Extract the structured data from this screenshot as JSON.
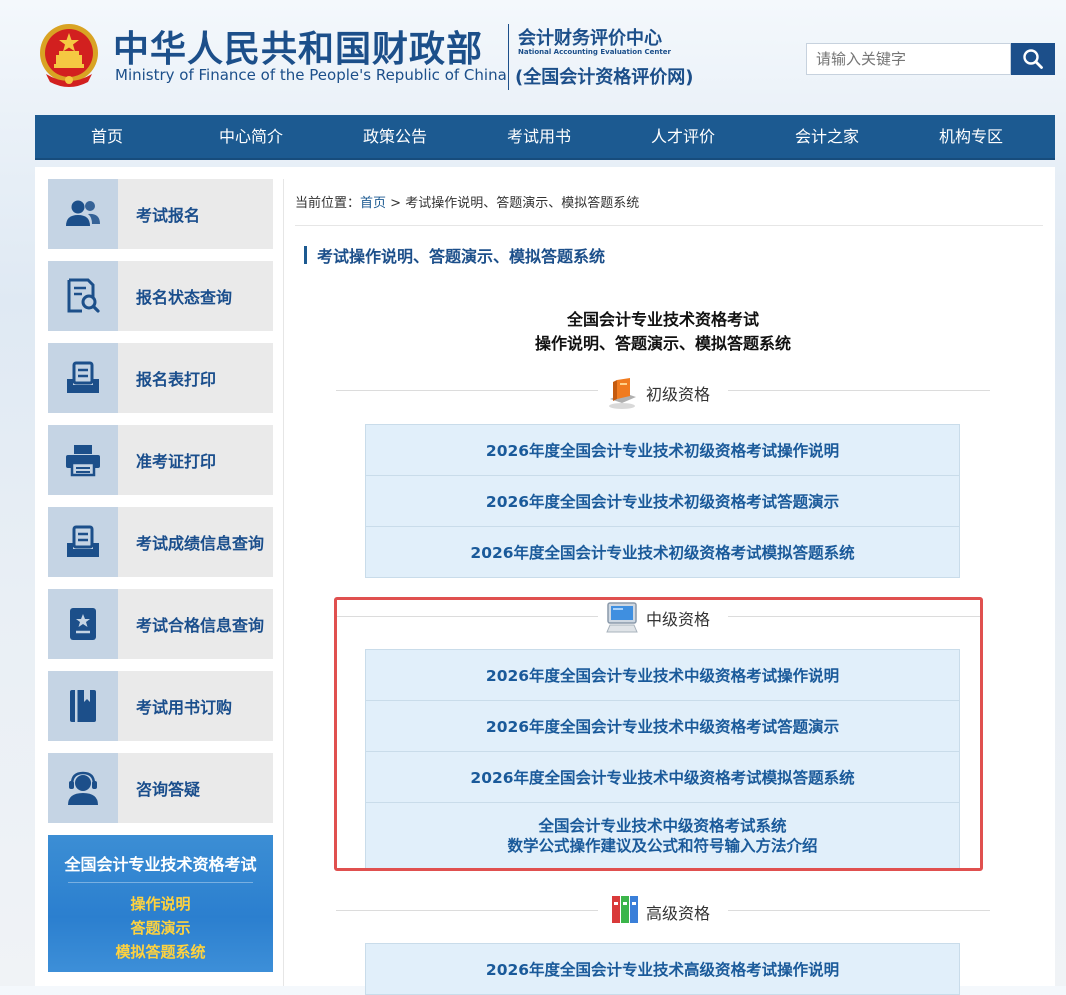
{
  "header": {
    "ministry_cn": "中华人民共和国财政部",
    "ministry_en": "Ministry of Finance of the People's Republic of China",
    "center_cn": "会计财务评价中心",
    "center_en": "National Accounting Evaluation Center",
    "center_site": "(全国会计资格评价网)",
    "search_placeholder": "请输入关键字"
  },
  "nav": [
    "首页",
    "中心简介",
    "政策公告",
    "考试用书",
    "人才评价",
    "会计之家",
    "机构专区"
  ],
  "sidebar": {
    "items": [
      {
        "label": "考试报名",
        "icon": "users-icon"
      },
      {
        "label": "报名状态查询",
        "icon": "document-search-icon"
      },
      {
        "label": "报名表打印",
        "icon": "form-print-icon"
      },
      {
        "label": "准考证打印",
        "icon": "printer-icon"
      },
      {
        "label": "考试成绩信息查询",
        "icon": "score-tray-icon"
      },
      {
        "label": "考试合格信息查询",
        "icon": "certificate-icon"
      },
      {
        "label": "考试用书订购",
        "icon": "book-icon"
      },
      {
        "label": "咨询答疑",
        "icon": "support-headset-icon"
      }
    ],
    "banner": {
      "title": "全国会计专业技术资格考试",
      "lines": [
        "操作说明",
        "答题演示",
        "模拟答题系统"
      ]
    }
  },
  "breadcrumb": {
    "prefix": "当前位置：",
    "home": "首页",
    "sep": " > ",
    "current": "考试操作说明、答题演示、模拟答题系统"
  },
  "page_title": "考试操作说明、答题演示、模拟答题系统",
  "main": {
    "heading1": "全国会计专业技术资格考试",
    "heading2": "操作说明、答题演示、模拟答题系统",
    "sections": [
      {
        "label": "初级资格",
        "links": [
          "2026年度全国会计专业技术初级资格考试操作说明",
          "2026年度全国会计专业技术初级资格考试答题演示",
          "2026年度全国会计专业技术初级资格考试模拟答题系统"
        ]
      },
      {
        "label": "中级资格",
        "links": [
          "2026年度全国会计专业技术中级资格考试操作说明",
          "2026年度全国会计专业技术中级资格考试答题演示",
          "2026年度全国会计专业技术中级资格考试模拟答题系统"
        ],
        "extra_line1": "全国会计专业技术中级资格考试系统",
        "extra_line2": "数学公式操作建议及公式和符号输入方法介绍"
      },
      {
        "label": "高级资格",
        "links": [
          "2026年度全国会计专业技术高级资格考试操作说明"
        ]
      }
    ]
  },
  "colors": {
    "brand": "#1c4f8a",
    "nav_bg": "#1c5a91",
    "link": "#1a5a9a",
    "highlight": "#e0504f"
  }
}
